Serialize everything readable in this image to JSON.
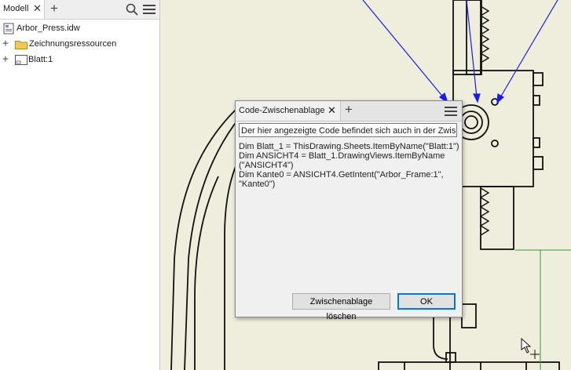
{
  "browser": {
    "tab_label": "Modell",
    "tab_close": "✕",
    "add_tab": "+",
    "expand_glyph": "+",
    "tree": [
      {
        "label": "Arbor_Press.idw",
        "icon": "idw-document-icon"
      },
      {
        "label": "Zeichnungsressourcen",
        "icon": "folder-icon"
      },
      {
        "label": "Blatt:1",
        "icon": "sheet-icon"
      }
    ]
  },
  "dialog": {
    "tab_label": "Code-Zwischenablage",
    "tab_close": "✕",
    "add_tab": "+",
    "info_text": "Der hier angezeigte Code befindet sich auch in der Zwischenablage",
    "code": "Dim Blatt_1 = ThisDrawing.Sheets.ItemByName(\"Blatt:1\")\nDim ANSICHT4 = Blatt_1.DrawingViews.ItemByName\n(\"ANSICHT4\")\nDim Kante0 = ANSICHT4.GetIntent(\"Arbor_Frame:1\",\n\"Kante0\")",
    "clear_button": "Zwischenablage löschen",
    "ok_button": "OK"
  },
  "colors": {
    "canvas_bg": "#efeedd",
    "drawing_line": "#111111",
    "leader_arrow": "#1a1aee",
    "guide_line": "#2e9e2e",
    "ok_focus": "#0078d7"
  }
}
